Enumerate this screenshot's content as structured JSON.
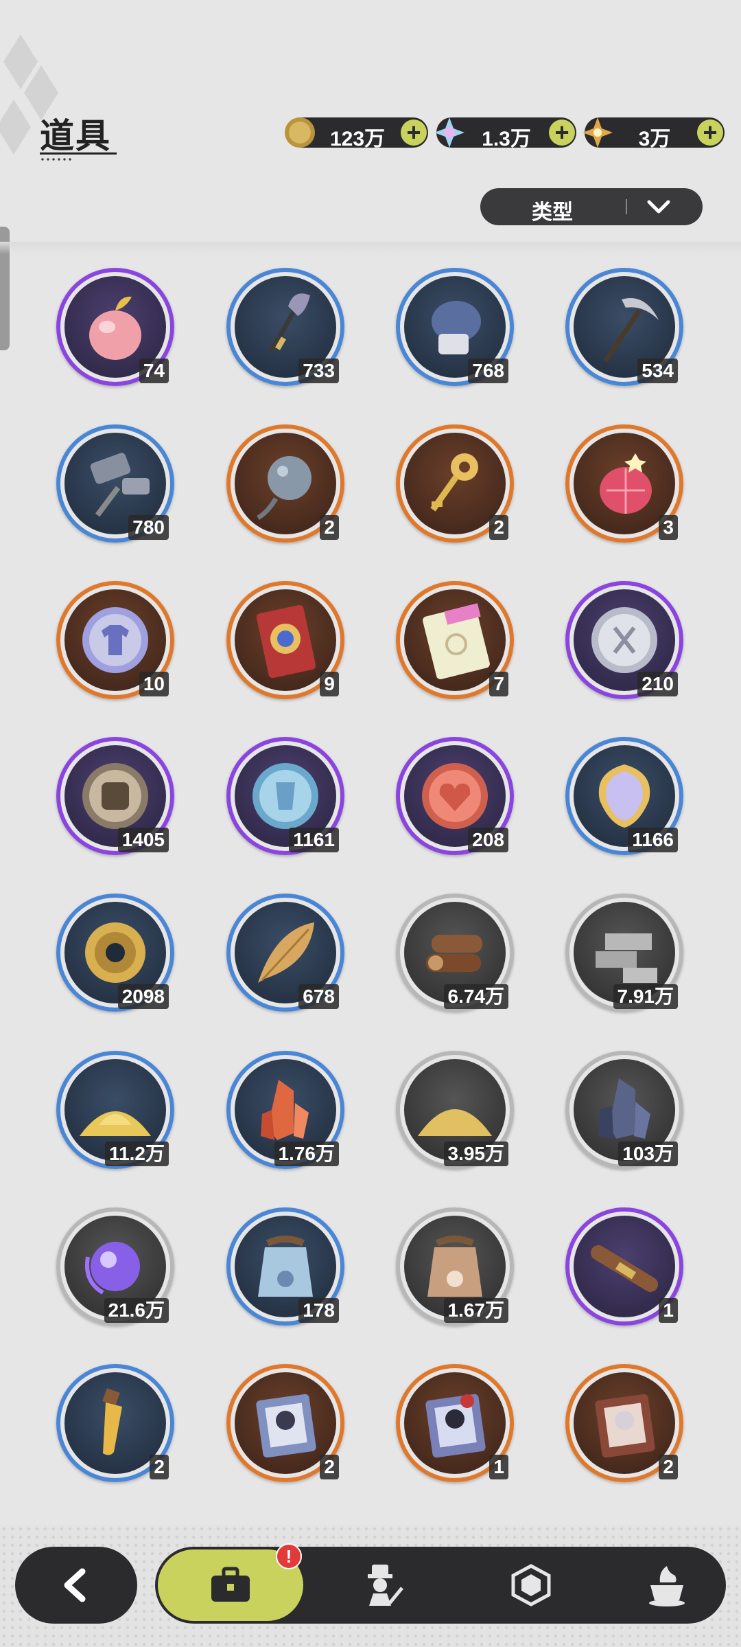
{
  "header": {
    "title": "道具"
  },
  "currencies": [
    {
      "icon": "gold-coin-icon",
      "amount": "123万"
    },
    {
      "icon": "crystal-star-icon",
      "amount": "1.3万"
    },
    {
      "icon": "golden-star-icon",
      "amount": "3万"
    }
  ],
  "filter": {
    "label": "类型"
  },
  "items": [
    {
      "icon": "pink-apple-icon",
      "count": "74",
      "rarity": "purple"
    },
    {
      "icon": "shovel-icon",
      "count": "733",
      "rarity": "blue"
    },
    {
      "icon": "boxing-glove-icon",
      "count": "768",
      "rarity": "blue"
    },
    {
      "icon": "pickaxe-icon",
      "count": "534",
      "rarity": "blue"
    },
    {
      "icon": "hammer-icon",
      "count": "780",
      "rarity": "blue"
    },
    {
      "icon": "spiked-ball-icon",
      "count": "2",
      "rarity": "orange"
    },
    {
      "icon": "golden-key-icon",
      "count": "2",
      "rarity": "orange"
    },
    {
      "icon": "ruby-fruit-icon",
      "count": "3",
      "rarity": "orange"
    },
    {
      "icon": "outfit-coin-icon",
      "count": "10",
      "rarity": "orange"
    },
    {
      "icon": "red-ticket-icon",
      "count": "9",
      "rarity": "orange"
    },
    {
      "icon": "rainbow-ticket-icon",
      "count": "7",
      "rarity": "orange"
    },
    {
      "icon": "silver-scissors-coin-icon",
      "count": "210",
      "rarity": "purple"
    },
    {
      "icon": "fist-coin-icon",
      "count": "1405",
      "rarity": "purple"
    },
    {
      "icon": "blue-crest-coin-icon",
      "count": "1161",
      "rarity": "purple"
    },
    {
      "icon": "heart-coin-icon",
      "count": "208",
      "rarity": "purple"
    },
    {
      "icon": "scale-gem-icon",
      "count": "1166",
      "rarity": "blue"
    },
    {
      "icon": "gear-icon",
      "count": "2098",
      "rarity": "blue"
    },
    {
      "icon": "golden-leaf-icon",
      "count": "678",
      "rarity": "blue"
    },
    {
      "icon": "wood-logs-icon",
      "count": "6.74万",
      "rarity": "gray"
    },
    {
      "icon": "stone-bricks-icon",
      "count": "7.91万",
      "rarity": "gray"
    },
    {
      "icon": "gold-sand-icon",
      "count": "11.2万",
      "rarity": "blue"
    },
    {
      "icon": "red-crystal-icon",
      "count": "1.76万",
      "rarity": "blue"
    },
    {
      "icon": "sand-pile-icon",
      "count": "3.95万",
      "rarity": "gray"
    },
    {
      "icon": "dark-crystal-icon",
      "count": "103万",
      "rarity": "gray"
    },
    {
      "icon": "purple-orb-icon",
      "count": "21.6万",
      "rarity": "gray"
    },
    {
      "icon": "blue-food-bag-icon",
      "count": "178",
      "rarity": "blue"
    },
    {
      "icon": "brown-food-bag-icon",
      "count": "1.67万",
      "rarity": "gray"
    },
    {
      "icon": "rope-bundle-icon",
      "count": "1",
      "rarity": "purple"
    },
    {
      "icon": "potion-vial-icon",
      "count": "2",
      "rarity": "blue"
    },
    {
      "icon": "character-book-blue-icon",
      "count": "2",
      "rarity": "orange"
    },
    {
      "icon": "character-book-red-icon",
      "count": "1",
      "rarity": "orange"
    },
    {
      "icon": "character-book-dark-icon",
      "count": "2",
      "rarity": "orange"
    }
  ],
  "nav": {
    "alert_badge": "!",
    "tabs": [
      {
        "name": "bag-tab",
        "icon": "briefcase-icon",
        "active": true
      },
      {
        "name": "characters-tab",
        "icon": "character-icon",
        "active": false
      },
      {
        "name": "gems-tab",
        "icon": "hexagon-gem-icon",
        "active": false
      },
      {
        "name": "food-tab",
        "icon": "dessert-icon",
        "active": false
      }
    ]
  }
}
